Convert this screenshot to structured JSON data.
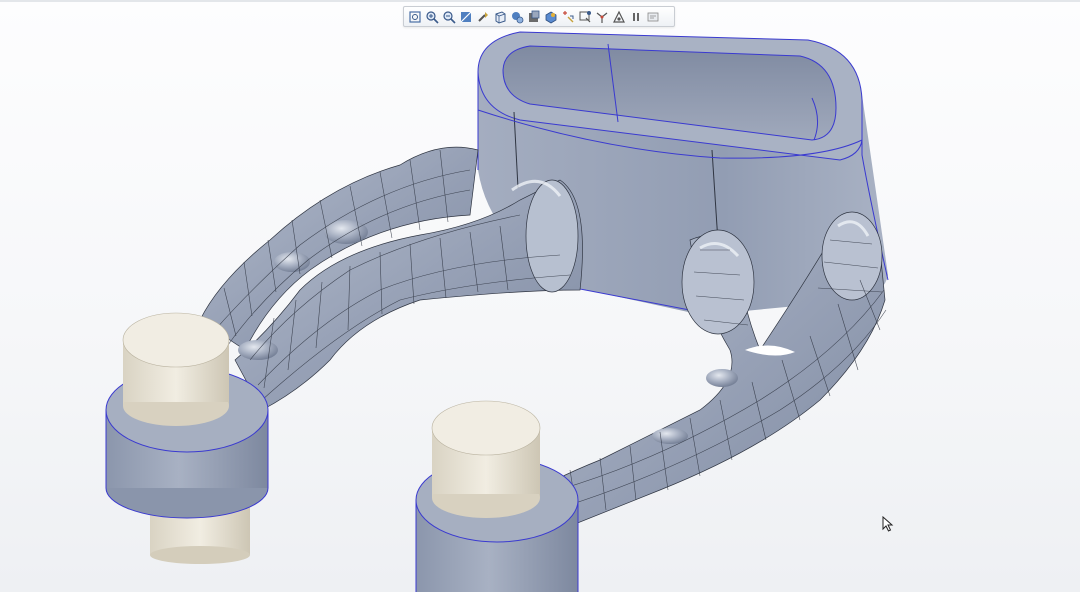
{
  "app": {
    "viewport": "3d-graphics-area",
    "model": "lattice-bracket-part"
  },
  "colors": {
    "background_top": "#fdfdfe",
    "background_bottom": "#eef0f3",
    "body_fill": "#97a1b6",
    "body_shade": "#8390a6",
    "body_highlight": "#c4cbd9",
    "edge_line": "#3a3ad0",
    "mesh_line": "#2f3542",
    "pin_fill": "#ece8dc",
    "pin_shade": "#d7d1c1"
  },
  "toolbar": {
    "buttons": [
      {
        "icon": "refit-icon"
      },
      {
        "icon": "zoom-in-icon"
      },
      {
        "icon": "zoom-out-icon"
      },
      {
        "icon": "repaint-icon"
      },
      {
        "icon": "reorient-icon"
      },
      {
        "icon": "saved-orientations-icon"
      },
      {
        "icon": "view-manager-icon"
      },
      {
        "icon": "display-style-icon"
      },
      {
        "icon": "appearance-icon"
      },
      {
        "icon": "datum-display-icon"
      },
      {
        "icon": "annotation-display-icon"
      },
      {
        "icon": "spin-center-icon"
      },
      {
        "icon": "perspective-icon"
      },
      {
        "icon": "pause-icon"
      },
      {
        "icon": "more-icon"
      }
    ]
  },
  "cursor": {
    "icon": "mouse-pointer-icon"
  }
}
